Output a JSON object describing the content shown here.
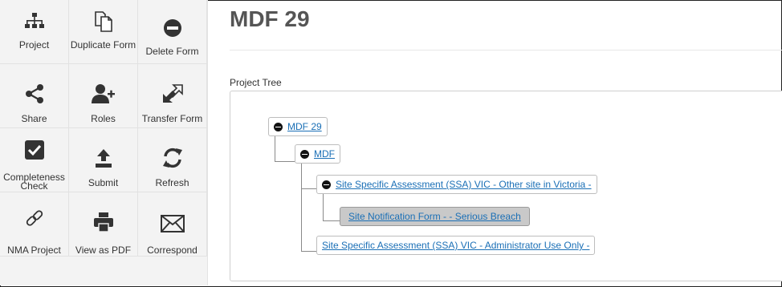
{
  "sidebar": {
    "tiles": [
      {
        "label": "Project",
        "icon": "sitemap-icon"
      },
      {
        "label": "Duplicate Form",
        "icon": "duplicate-icon"
      },
      {
        "label": "Delete Form",
        "icon": "minus-circle-icon"
      },
      {
        "label": "Share",
        "icon": "share-icon"
      },
      {
        "label": "Roles",
        "icon": "user-plus-icon"
      },
      {
        "label": "Transfer Form",
        "icon": "transfer-icon"
      },
      {
        "label": "Completeness Check",
        "icon": "checkbox-icon"
      },
      {
        "label": "Submit",
        "icon": "upload-icon"
      },
      {
        "label": "Refresh",
        "icon": "refresh-icon"
      },
      {
        "label": "NMA Project",
        "icon": "link-icon"
      },
      {
        "label": "View as PDF",
        "icon": "printer-icon"
      },
      {
        "label": "Correspond",
        "icon": "envelope-icon"
      }
    ]
  },
  "main": {
    "title": "MDF 29",
    "tree_label": "Project Tree",
    "tree": {
      "root": "MDF 29",
      "child": "MDF",
      "grandchild_1": "Site Specific Assessment (SSA) VIC - Other site in Victoria -",
      "greatgrandchild": "Site Notification Form - - Serious Breach",
      "grandchild_2": "Site Specific Assessment (SSA) VIC - Administrator Use Only -"
    }
  },
  "colors": {
    "link": "#1a6fb6",
    "sidebar_bg": "#f3f3f3",
    "selected_bg": "#c9c9c9"
  }
}
